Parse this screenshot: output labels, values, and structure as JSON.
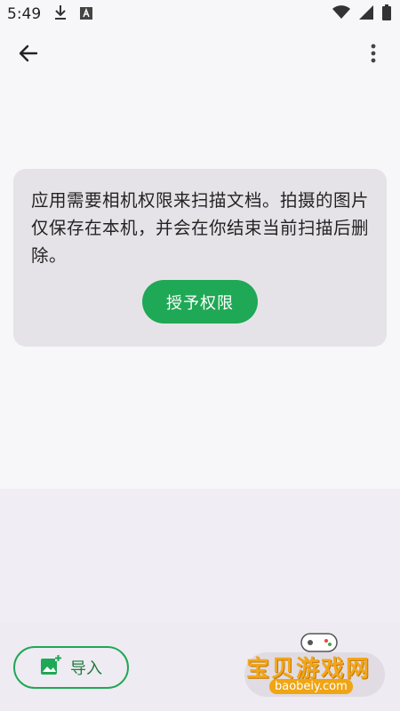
{
  "status_bar": {
    "time": "5:49",
    "icons": [
      "download-icon",
      "font-a-icon",
      "wifi-icon",
      "signal-icon",
      "battery-icon"
    ]
  },
  "app_bar": {
    "back_icon": "arrow-left-icon",
    "menu_icon": "more-vert-icon"
  },
  "permission_card": {
    "message": "应用需要相机权限来扫描文档。拍摄的图片仅保存在本机，并会在你结束当前扫描后删除。",
    "grant_button_label": "授予权限"
  },
  "bottom": {
    "import_label": "导入",
    "import_icon": "add-photo-icon"
  },
  "watermark": {
    "text": "宝贝游戏网",
    "url": "baobeiy.com"
  },
  "colors": {
    "accent": "#1fa855",
    "card_bg": "#e6e3e8",
    "bottom_bg": "#efebf2"
  }
}
